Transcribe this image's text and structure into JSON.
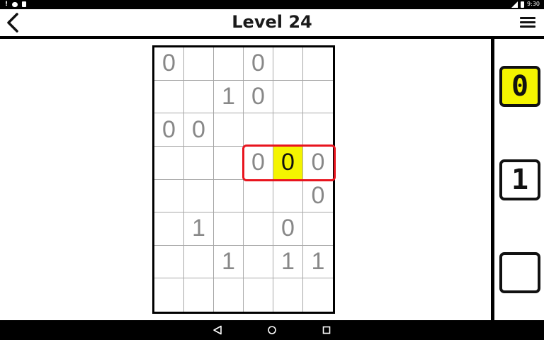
{
  "status_bar": {
    "time": "9:30",
    "alert_glyph": "!",
    "icons": [
      "alert-icon",
      "chat-icon",
      "clipboard-icon",
      "signal-icon",
      "battery-icon"
    ]
  },
  "header": {
    "title": "Level 24",
    "back_icon": "chevron-left-icon",
    "menu_icon": "hamburger-menu-icon"
  },
  "board": {
    "columns": 6,
    "rows": 8,
    "cells": [
      [
        "0",
        "",
        "",
        "0",
        "",
        ""
      ],
      [
        "",
        "",
        "1",
        "0",
        "",
        ""
      ],
      [
        "0",
        "0",
        "",
        "",
        "",
        ""
      ],
      [
        "",
        "",
        "",
        "0",
        "0",
        "0"
      ],
      [
        "",
        "",
        "",
        "",
        "",
        "0"
      ],
      [
        "",
        "1",
        "",
        "",
        "0",
        ""
      ],
      [
        "",
        "",
        "1",
        "",
        "1",
        "1"
      ],
      [
        "",
        "",
        "",
        "",
        "",
        ""
      ]
    ],
    "selected": {
      "row": 3,
      "col": 4
    },
    "highlight": {
      "row": 3,
      "col_start": 3,
      "col_end": 5
    }
  },
  "palette": {
    "buttons": [
      {
        "label": "0",
        "active": true
      },
      {
        "label": "1",
        "active": false
      },
      {
        "label": "",
        "active": false
      }
    ]
  },
  "nav_bar": {
    "icons": [
      "nav-back-icon",
      "nav-home-icon",
      "nav-recent-icon"
    ]
  },
  "colors": {
    "selected_cell": "#f4f400",
    "highlight_outline": "#e8141e",
    "given_digit": "#888888",
    "grid_line": "#a8a8a8"
  }
}
